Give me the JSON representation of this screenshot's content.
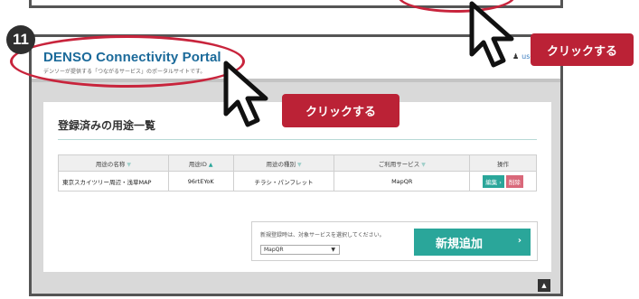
{
  "step": {
    "number": "11"
  },
  "portal": {
    "title": "DENSO Connectivity Portal",
    "subtitle": "デンソーが提供する「つながるサービス」のポータルサイトです。",
    "user_label": "user"
  },
  "panel": {
    "title": "登録済みの用途一覧",
    "table": {
      "headers": [
        "用途の名称",
        "用途ID",
        "用途の種別",
        "ご利用サービス",
        "操作"
      ],
      "rows": [
        {
          "name": "東京スカイツリー周辺・浅草MAP",
          "id": "96rtEYoK",
          "type": "チラシ・パンフレット",
          "service": "MapQR",
          "edit": "編集 ›",
          "delete": "削除"
        }
      ]
    },
    "add": {
      "note": "新規登録時は、対象サービスを選択してください。",
      "selected_service": "MapQR",
      "button_label": "新規追加"
    }
  },
  "callouts": {
    "primary": "クリックする",
    "secondary": "クリックする"
  },
  "colors": {
    "accent": "#2aa69a",
    "highlight": "#c8243c",
    "callout": "#bb2236",
    "title": "#1b6a9a"
  },
  "icons": {
    "scroll_top": "caret-up-icon",
    "cursor": "mouse-pointer-icon",
    "user": "person-icon"
  }
}
